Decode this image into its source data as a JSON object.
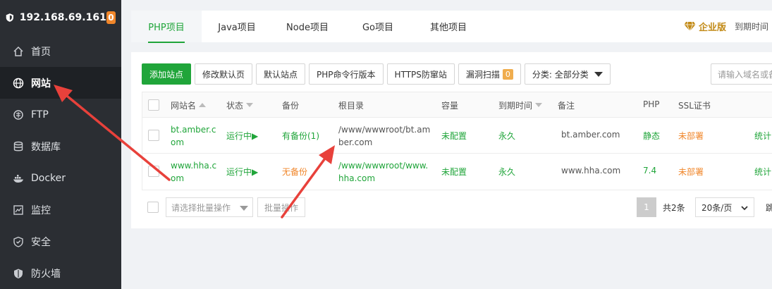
{
  "sidebar": {
    "ip": "192.168.69.161",
    "badge": "0",
    "items": [
      {
        "label": "首页",
        "icon": "home-icon"
      },
      {
        "label": "网站",
        "icon": "globe-icon"
      },
      {
        "label": "FTP",
        "icon": "ftp-icon"
      },
      {
        "label": "数据库",
        "icon": "database-icon"
      },
      {
        "label": "Docker",
        "icon": "docker-icon"
      },
      {
        "label": "监控",
        "icon": "monitor-icon"
      },
      {
        "label": "安全",
        "icon": "shield-check-icon"
      },
      {
        "label": "防火墙",
        "icon": "firewall-icon"
      }
    ]
  },
  "tabs": [
    "PHP项目",
    "Java项目",
    "Node项目",
    "Go项目",
    "其他项目"
  ],
  "header": {
    "edition": "企业版",
    "expiry": "到期时间"
  },
  "toolbar": {
    "add_site": "添加站点",
    "edit_default": "修改默认页",
    "default_site": "默认站点",
    "php_cli": "PHP命令行版本",
    "https_guard": "HTTPS防窜站",
    "vuln_scan": "漏洞扫描",
    "vuln_count": "0",
    "category": "分类: 全部分类",
    "search_placeholder": "请输入域名或备"
  },
  "table": {
    "headers": [
      "网站名",
      "状态",
      "备份",
      "根目录",
      "容量",
      "到期时间",
      "备注",
      "PHP",
      "SSL证书"
    ],
    "rows": [
      {
        "name_l1": "bt.amber.c",
        "name_l2": "om",
        "status": "运行中▶",
        "backup": "有备份(1)",
        "root_l1": "/www/wwwroot/bt.am",
        "root_l2": "ber.com",
        "capacity": "未配置",
        "expiry": "永久",
        "note": "bt.amber.com",
        "php": "静态",
        "ssl": "未部署",
        "stats": "统计"
      },
      {
        "name_l1": "www.hha.c",
        "name_l2": "om",
        "status": "运行中▶",
        "backup": "无备份",
        "root_l1": "/www/wwwroot/www.",
        "root_l2": "hha.com",
        "capacity": "未配置",
        "expiry": "永久",
        "note": "www.hha.com",
        "php": "7.4",
        "ssl": "未部署",
        "stats": "统计"
      }
    ]
  },
  "footer": {
    "batch_placeholder": "请选择批量操作",
    "batch_button": "批量操作",
    "page": "1",
    "total": "共2条",
    "page_size": "20条/页",
    "jump": "跳"
  },
  "colors": {
    "accent": "#20a53a",
    "sidebar_bg": "#2b2e33",
    "warning": "#f0862a",
    "annotation": "#e8413b"
  }
}
